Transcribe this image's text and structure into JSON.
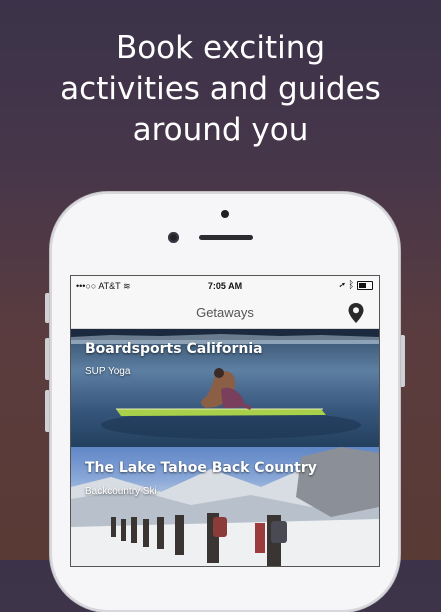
{
  "promo": {
    "headline_line1": "Book exciting",
    "headline_line2": "activities and guides",
    "headline_line3": "around you"
  },
  "statusbar": {
    "carrier": "•••○○ AT&T",
    "time": "7:05 AM"
  },
  "navbar": {
    "title": "Getaways",
    "location_icon": "map-pin-icon"
  },
  "cards": [
    {
      "title": "Boardsports California",
      "subtitle": "SUP Yoga"
    },
    {
      "title": "The Lake Tahoe Back Country",
      "subtitle": "Backcountry Ski"
    }
  ]
}
